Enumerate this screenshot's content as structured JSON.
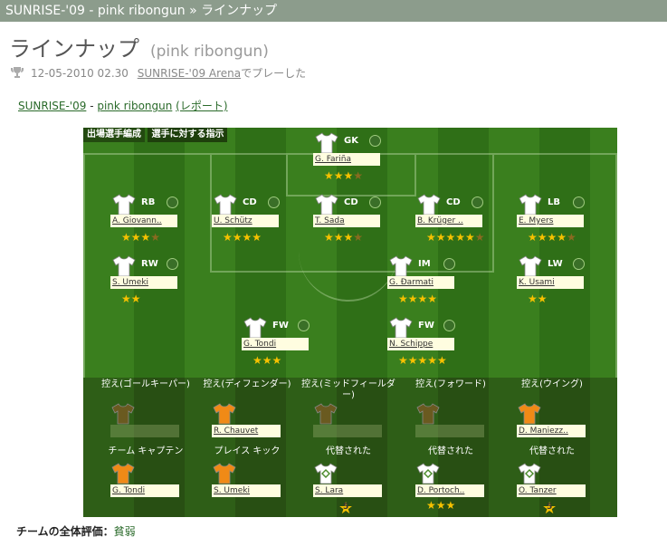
{
  "header": {
    "breadcrumb": "SUNRISE-'09 - pink ribongun » ラインナップ"
  },
  "title": {
    "main": "ラインナップ",
    "sub": "(pink ribongun)"
  },
  "meta": {
    "date": "12-05-2010 02.30",
    "venue": "SUNRISE-'09 Arena",
    "suffix": "でプレーした"
  },
  "links": {
    "team1": "SUNRISE-'09",
    "sep": "-",
    "team2": "pink ribongun",
    "report": "(レポート)"
  },
  "tabs": {
    "formation": "出場選手編成",
    "instructions": "選手に対する指示"
  },
  "players": [
    {
      "pos": "GK",
      "name": "G. Fariña",
      "stars": "★★★",
      "extra": "★"
    },
    {
      "pos": "RB",
      "name": "A. Giovann..",
      "stars": "★★★",
      "extra": "★"
    },
    {
      "pos": "CD",
      "name": "U. Schütz",
      "stars": "★★★★",
      "extra": ""
    },
    {
      "pos": "CD",
      "name": "T. Sada",
      "stars": "★★★",
      "extra": "★"
    },
    {
      "pos": "CD",
      "name": "B. Krüger ..",
      "stars": "★★★★★",
      "extra": "★"
    },
    {
      "pos": "LB",
      "name": "E. Myers",
      "stars": "★★★★",
      "extra": "★"
    },
    {
      "pos": "RW",
      "name": "S. Umeki",
      "stars": "★★",
      "extra": ""
    },
    {
      "pos": "IM",
      "name": "G. Ðarmati",
      "stars": "★★★★",
      "extra": ""
    },
    {
      "pos": "LW",
      "name": "K. Usami",
      "stars": "★★",
      "extra": ""
    },
    {
      "pos": "FW",
      "name": "G. Tondi",
      "stars": "★★★",
      "extra": ""
    },
    {
      "pos": "FW",
      "name": "N. Schippe",
      "stars": "★★★★★",
      "extra": ""
    }
  ],
  "bench": {
    "labels": [
      "控え(ゴールキーパー)",
      "控え(ディフェンダー)",
      "控え(ミッドフィールダー)",
      "控え(フォワード)",
      "控え(ウイング)"
    ],
    "names": [
      "",
      "R. Chauvet",
      "",
      "",
      "D. Maniezz.."
    ]
  },
  "roles": {
    "labels": [
      "チーム キャプテン",
      "プレイス キック",
      "代替された",
      "代替された",
      "代替された"
    ],
    "names": [
      "G. Tondi",
      "S. Umeki",
      "S. Lara",
      "D. Portoch..",
      "O. Tanzer"
    ],
    "stars": [
      "",
      "",
      "5",
      "★★★",
      "5"
    ]
  },
  "footer": {
    "label": "チームの全体評価：",
    "value": "貧弱"
  },
  "colors": {
    "pitch": "#3a7f1e",
    "orange_shirt": "#f08a16",
    "topbar": "#8c9c8c"
  }
}
